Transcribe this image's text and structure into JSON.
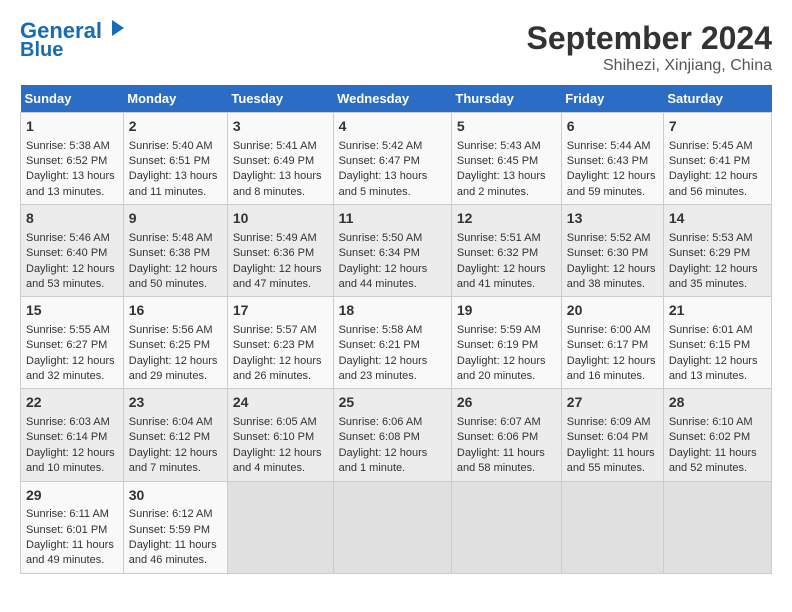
{
  "header": {
    "logo_line1": "General",
    "logo_line2": "Blue",
    "title": "September 2024",
    "subtitle": "Shihezi, Xinjiang, China"
  },
  "days_of_week": [
    "Sunday",
    "Monday",
    "Tuesday",
    "Wednesday",
    "Thursday",
    "Friday",
    "Saturday"
  ],
  "weeks": [
    [
      {
        "day": 1,
        "info": "Sunrise: 5:38 AM\nSunset: 6:52 PM\nDaylight: 13 hours and 13 minutes."
      },
      {
        "day": 2,
        "info": "Sunrise: 5:40 AM\nSunset: 6:51 PM\nDaylight: 13 hours and 11 minutes."
      },
      {
        "day": 3,
        "info": "Sunrise: 5:41 AM\nSunset: 6:49 PM\nDaylight: 13 hours and 8 minutes."
      },
      {
        "day": 4,
        "info": "Sunrise: 5:42 AM\nSunset: 6:47 PM\nDaylight: 13 hours and 5 minutes."
      },
      {
        "day": 5,
        "info": "Sunrise: 5:43 AM\nSunset: 6:45 PM\nDaylight: 13 hours and 2 minutes."
      },
      {
        "day": 6,
        "info": "Sunrise: 5:44 AM\nSunset: 6:43 PM\nDaylight: 12 hours and 59 minutes."
      },
      {
        "day": 7,
        "info": "Sunrise: 5:45 AM\nSunset: 6:41 PM\nDaylight: 12 hours and 56 minutes."
      }
    ],
    [
      {
        "day": 8,
        "info": "Sunrise: 5:46 AM\nSunset: 6:40 PM\nDaylight: 12 hours and 53 minutes."
      },
      {
        "day": 9,
        "info": "Sunrise: 5:48 AM\nSunset: 6:38 PM\nDaylight: 12 hours and 50 minutes."
      },
      {
        "day": 10,
        "info": "Sunrise: 5:49 AM\nSunset: 6:36 PM\nDaylight: 12 hours and 47 minutes."
      },
      {
        "day": 11,
        "info": "Sunrise: 5:50 AM\nSunset: 6:34 PM\nDaylight: 12 hours and 44 minutes."
      },
      {
        "day": 12,
        "info": "Sunrise: 5:51 AM\nSunset: 6:32 PM\nDaylight: 12 hours and 41 minutes."
      },
      {
        "day": 13,
        "info": "Sunrise: 5:52 AM\nSunset: 6:30 PM\nDaylight: 12 hours and 38 minutes."
      },
      {
        "day": 14,
        "info": "Sunrise: 5:53 AM\nSunset: 6:29 PM\nDaylight: 12 hours and 35 minutes."
      }
    ],
    [
      {
        "day": 15,
        "info": "Sunrise: 5:55 AM\nSunset: 6:27 PM\nDaylight: 12 hours and 32 minutes."
      },
      {
        "day": 16,
        "info": "Sunrise: 5:56 AM\nSunset: 6:25 PM\nDaylight: 12 hours and 29 minutes."
      },
      {
        "day": 17,
        "info": "Sunrise: 5:57 AM\nSunset: 6:23 PM\nDaylight: 12 hours and 26 minutes."
      },
      {
        "day": 18,
        "info": "Sunrise: 5:58 AM\nSunset: 6:21 PM\nDaylight: 12 hours and 23 minutes."
      },
      {
        "day": 19,
        "info": "Sunrise: 5:59 AM\nSunset: 6:19 PM\nDaylight: 12 hours and 20 minutes."
      },
      {
        "day": 20,
        "info": "Sunrise: 6:00 AM\nSunset: 6:17 PM\nDaylight: 12 hours and 16 minutes."
      },
      {
        "day": 21,
        "info": "Sunrise: 6:01 AM\nSunset: 6:15 PM\nDaylight: 12 hours and 13 minutes."
      }
    ],
    [
      {
        "day": 22,
        "info": "Sunrise: 6:03 AM\nSunset: 6:14 PM\nDaylight: 12 hours and 10 minutes."
      },
      {
        "day": 23,
        "info": "Sunrise: 6:04 AM\nSunset: 6:12 PM\nDaylight: 12 hours and 7 minutes."
      },
      {
        "day": 24,
        "info": "Sunrise: 6:05 AM\nSunset: 6:10 PM\nDaylight: 12 hours and 4 minutes."
      },
      {
        "day": 25,
        "info": "Sunrise: 6:06 AM\nSunset: 6:08 PM\nDaylight: 12 hours and 1 minute."
      },
      {
        "day": 26,
        "info": "Sunrise: 6:07 AM\nSunset: 6:06 PM\nDaylight: 11 hours and 58 minutes."
      },
      {
        "day": 27,
        "info": "Sunrise: 6:09 AM\nSunset: 6:04 PM\nDaylight: 11 hours and 55 minutes."
      },
      {
        "day": 28,
        "info": "Sunrise: 6:10 AM\nSunset: 6:02 PM\nDaylight: 11 hours and 52 minutes."
      }
    ],
    [
      {
        "day": 29,
        "info": "Sunrise: 6:11 AM\nSunset: 6:01 PM\nDaylight: 11 hours and 49 minutes."
      },
      {
        "day": 30,
        "info": "Sunrise: 6:12 AM\nSunset: 5:59 PM\nDaylight: 11 hours and 46 minutes."
      },
      {
        "day": null,
        "info": ""
      },
      {
        "day": null,
        "info": ""
      },
      {
        "day": null,
        "info": ""
      },
      {
        "day": null,
        "info": ""
      },
      {
        "day": null,
        "info": ""
      }
    ]
  ]
}
